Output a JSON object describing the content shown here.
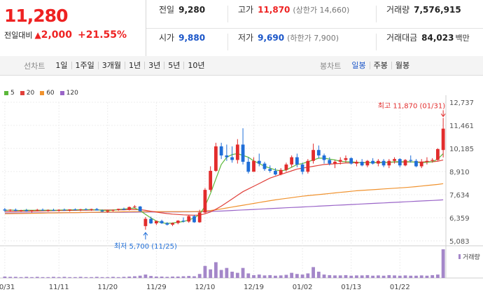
{
  "quote": {
    "price": "11,280",
    "change_label": "전일대비",
    "change_arrow": "▲",
    "change_value": "2,000",
    "change_pct": "+21.55%",
    "prev_close": {
      "label": "전일",
      "value": "9,280"
    },
    "high": {
      "label": "고가",
      "value": "11,870",
      "sub": "(상한가 14,660)"
    },
    "volume": {
      "label": "거래량",
      "value": "7,576,915"
    },
    "open": {
      "label": "시가",
      "value": "9,880"
    },
    "low": {
      "label": "저가",
      "value": "9,690",
      "sub": "(하한가 7,900)"
    },
    "turnover": {
      "label": "거래대금",
      "value": "84,023",
      "unit": "백만"
    }
  },
  "toolbar": {
    "line_chart_title": "선차트",
    "line_periods": [
      "1일",
      "1주일",
      "3개월",
      "1년",
      "3년",
      "5년",
      "10년"
    ],
    "candle_title": "봉차트",
    "candle_periods": [
      "일봉",
      "주봉",
      "월봉"
    ],
    "candle_active": "일봉"
  },
  "legend": [
    {
      "label": "5",
      "color": "#5cb83a"
    },
    {
      "label": "20",
      "color": "#e0403a"
    },
    {
      "label": "60",
      "color": "#f0922e"
    },
    {
      "label": "120",
      "color": "#9a65c8"
    }
  ],
  "colors": {
    "up": "#e22c2c",
    "down": "#1f6ed8",
    "volume": "#a487c9"
  },
  "chart_data": {
    "type": "candlestick",
    "ylim": [
      5083,
      12737
    ],
    "y_ticks": [
      "12,737",
      "11,461",
      "10,185",
      "8,910",
      "7,634",
      "6,359",
      "5,083"
    ],
    "x_ticks": [
      "10/31",
      "11/11",
      "11/20",
      "11/29",
      "12/10",
      "12/19",
      "01/02",
      "01/13",
      "01/22"
    ],
    "max_label": "최고 11,870 (01/31)",
    "min_label": "최저 5,700 (11/25)",
    "volume_label": "거래량",
    "candles": [
      [
        6820,
        6900,
        6690,
        6760
      ],
      [
        6760,
        6830,
        6700,
        6800
      ],
      [
        6800,
        6870,
        6720,
        6740
      ],
      [
        6740,
        6800,
        6680,
        6780
      ],
      [
        6780,
        6850,
        6700,
        6720
      ],
      [
        6720,
        6790,
        6650,
        6770
      ],
      [
        6770,
        6850,
        6720,
        6800
      ],
      [
        6800,
        6870,
        6740,
        6760
      ],
      [
        6760,
        6820,
        6690,
        6790
      ],
      [
        6790,
        6860,
        6730,
        6750
      ],
      [
        6750,
        6830,
        6690,
        6800
      ],
      [
        6800,
        6870,
        6740,
        6770
      ],
      [
        6770,
        6830,
        6700,
        6820
      ],
      [
        6820,
        6880,
        6760,
        6790
      ],
      [
        6790,
        6850,
        6720,
        6830
      ],
      [
        6830,
        6890,
        6770,
        6800
      ],
      [
        6800,
        6860,
        6740,
        6840
      ],
      [
        6840,
        6900,
        6780,
        6760
      ],
      [
        6760,
        6820,
        6680,
        6700
      ],
      [
        6700,
        6780,
        6630,
        6760
      ],
      [
        6760,
        6820,
        6700,
        6790
      ],
      [
        6790,
        6860,
        6740,
        6850
      ],
      [
        6850,
        6920,
        6790,
        6800
      ],
      [
        6800,
        6980,
        6760,
        6950
      ],
      [
        6950,
        7060,
        6900,
        6980
      ],
      [
        6980,
        7010,
        6700,
        6720
      ],
      [
        5900,
        6400,
        5700,
        6300
      ],
      [
        6300,
        6420,
        6020,
        6050
      ],
      [
        6050,
        6200,
        5960,
        6180
      ],
      [
        6180,
        6250,
        6020,
        6060
      ],
      [
        6060,
        6120,
        5930,
        5980
      ],
      [
        5980,
        6100,
        5900,
        6070
      ],
      [
        6070,
        6230,
        6000,
        6200
      ],
      [
        6200,
        6380,
        6100,
        6150
      ],
      [
        6150,
        6500,
        6080,
        6450
      ],
      [
        6450,
        6520,
        6080,
        6110
      ],
      [
        6110,
        6800,
        6080,
        6650
      ],
      [
        6650,
        8000,
        6600,
        7900
      ],
      [
        7900,
        9200,
        7800,
        8950
      ],
      [
        8950,
        10500,
        8900,
        10300
      ],
      [
        10300,
        10500,
        9600,
        9800
      ],
      [
        9800,
        10400,
        9500,
        9700
      ],
      [
        9700,
        10300,
        9400,
        9550
      ],
      [
        9550,
        10700,
        9350,
        10400
      ],
      [
        10400,
        11300,
        9300,
        9450
      ],
      [
        9450,
        9700,
        8800,
        8900
      ],
      [
        8900,
        9700,
        8900,
        9500
      ],
      [
        9500,
        9900,
        9200,
        9350
      ],
      [
        9350,
        9450,
        8950,
        9050
      ],
      [
        9050,
        9250,
        8850,
        8950
      ],
      [
        8950,
        9100,
        8700,
        8750
      ],
      [
        8750,
        9100,
        8700,
        9000
      ],
      [
        9000,
        9400,
        8900,
        9300
      ],
      [
        9300,
        9800,
        9150,
        9700
      ],
      [
        9700,
        9900,
        9150,
        9300
      ],
      [
        9300,
        9400,
        8750,
        8900
      ],
      [
        8900,
        9600,
        8800,
        9500
      ],
      [
        9500,
        10450,
        9350,
        10100
      ],
      [
        10100,
        10350,
        9650,
        9800
      ],
      [
        9800,
        9900,
        9350,
        9550
      ],
      [
        9550,
        9700,
        9250,
        9350
      ],
      [
        9350,
        9550,
        9100,
        9450
      ],
      [
        9450,
        9700,
        9300,
        9550
      ],
      [
        9550,
        9800,
        9400,
        9650
      ],
      [
        9650,
        9700,
        9300,
        9350
      ],
      [
        9350,
        9550,
        9200,
        9450
      ],
      [
        9450,
        9600,
        9200,
        9250
      ],
      [
        9250,
        9550,
        9150,
        9500
      ],
      [
        9500,
        9650,
        9300,
        9350
      ],
      [
        9350,
        9600,
        9200,
        9500
      ],
      [
        9500,
        9600,
        9150,
        9250
      ],
      [
        9250,
        9600,
        9100,
        9500
      ],
      [
        9500,
        9700,
        9350,
        9600
      ],
      [
        9600,
        9650,
        9150,
        9250
      ],
      [
        9250,
        9600,
        9200,
        9550
      ],
      [
        9550,
        9800,
        9400,
        9500
      ],
      [
        9500,
        9600,
        9150,
        9200
      ],
      [
        9200,
        9600,
        9100,
        9450
      ],
      [
        9450,
        9700,
        9300,
        9500
      ],
      [
        9500,
        9650,
        9400,
        9550
      ],
      [
        9550,
        10200,
        9500,
        10150
      ],
      [
        10100,
        11870,
        9690,
        11280
      ]
    ],
    "ma5": [
      6760,
      6790,
      6770,
      6760,
      6780,
      6770,
      6780,
      6770,
      6780,
      6770,
      6780,
      6790,
      6790,
      6800,
      6800,
      6810,
      6810,
      6790,
      6780,
      6760,
      6780,
      6810,
      6840,
      6870,
      6900,
      6750,
      6550,
      6350,
      6180,
      6080,
      6050,
      6070,
      6110,
      6150,
      6240,
      6350,
      6550,
      7000,
      7700,
      8500,
      9300,
      9700,
      9850,
      9900,
      9800,
      9700,
      9500,
      9350,
      9200,
      9100,
      9000,
      8950,
      9000,
      9150,
      9300,
      9350,
      9450,
      9550,
      9650,
      9650,
      9600,
      9550,
      9480,
      9450,
      9450,
      9420,
      9400,
      9400,
      9410,
      9400,
      9400,
      9420,
      9450,
      9450,
      9450,
      9450,
      9420,
      9400,
      9420,
      9450,
      9600,
      9900
    ],
    "ma20": [
      6700,
      6705,
      6710,
      6715,
      6720,
      6725,
      6730,
      6740,
      6745,
      6750,
      6755,
      6760,
      6765,
      6770,
      6775,
      6780,
      6785,
      6790,
      6790,
      6790,
      6790,
      6795,
      6800,
      6810,
      6820,
      6810,
      6770,
      6720,
      6670,
      6630,
      6590,
      6560,
      6540,
      6520,
      6510,
      6500,
      6510,
      6580,
      6680,
      6830,
      7000,
      7200,
      7400,
      7600,
      7800,
      7950,
      8100,
      8250,
      8400,
      8550,
      8650,
      8750,
      8850,
      8950,
      9050,
      9100,
      9150,
      9200,
      9250,
      9300,
      9320,
      9340,
      9360,
      9380,
      9390,
      9400,
      9400,
      9410,
      9410,
      9420,
      9420,
      9420,
      9430,
      9430,
      9430,
      9440,
      9440,
      9440,
      9450,
      9450,
      9480,
      9550
    ],
    "ma60": [
      6580,
      6585,
      6590,
      6595,
      6600,
      6605,
      6610,
      6615,
      6620,
      6625,
      6630,
      6635,
      6640,
      6645,
      6650,
      6655,
      6660,
      6665,
      6670,
      6675,
      6680,
      6685,
      6690,
      6695,
      6700,
      6700,
      6700,
      6700,
      6700,
      6700,
      6700,
      6700,
      6700,
      6700,
      6700,
      6700,
      6710,
      6730,
      6760,
      6800,
      6850,
      6900,
      6950,
      7000,
      7050,
      7100,
      7150,
      7200,
      7250,
      7300,
      7350,
      7390,
      7430,
      7470,
      7510,
      7550,
      7580,
      7610,
      7640,
      7670,
      7700,
      7730,
      7760,
      7790,
      7820,
      7850,
      7870,
      7890,
      7910,
      7930,
      7950,
      7970,
      7990,
      8010,
      8030,
      8050,
      8080,
      8110,
      8140,
      8170,
      8200,
      8240
    ],
    "ma120": [
      6620,
      6622,
      6624,
      6626,
      6628,
      6630,
      6632,
      6634,
      6636,
      6638,
      6640,
      6642,
      6644,
      6646,
      6648,
      6650,
      6652,
      6654,
      6656,
      6658,
      6660,
      6662,
      6664,
      6666,
      6668,
      6670,
      6672,
      6674,
      6676,
      6678,
      6680,
      6682,
      6684,
      6686,
      6688,
      6690,
      6695,
      6700,
      6710,
      6720,
      6730,
      6745,
      6760,
      6775,
      6790,
      6805,
      6820,
      6835,
      6850,
      6865,
      6880,
      6895,
      6910,
      6925,
      6940,
      6955,
      6970,
      6985,
      7000,
      7015,
      7030,
      7045,
      7060,
      7075,
      7090,
      7105,
      7120,
      7135,
      7150,
      7165,
      7180,
      7195,
      7210,
      7225,
      7240,
      7255,
      7270,
      7285,
      7300,
      7315,
      7330,
      7350
    ],
    "volume": [
      5,
      4,
      4,
      3,
      4,
      3,
      4,
      3,
      3,
      4,
      3,
      4,
      3,
      3,
      4,
      3,
      3,
      4,
      3,
      3,
      4,
      3,
      4,
      5,
      6,
      8,
      12,
      7,
      5,
      5,
      4,
      5,
      5,
      6,
      7,
      6,
      14,
      42,
      30,
      55,
      28,
      35,
      22,
      18,
      35,
      16,
      10,
      12,
      9,
      10,
      8,
      9,
      11,
      18,
      14,
      12,
      16,
      38,
      22,
      12,
      10,
      9,
      9,
      10,
      8,
      9,
      9,
      10,
      8,
      9,
      8,
      10,
      9,
      8,
      9,
      8,
      8,
      9,
      8,
      10,
      12,
      100
    ]
  }
}
